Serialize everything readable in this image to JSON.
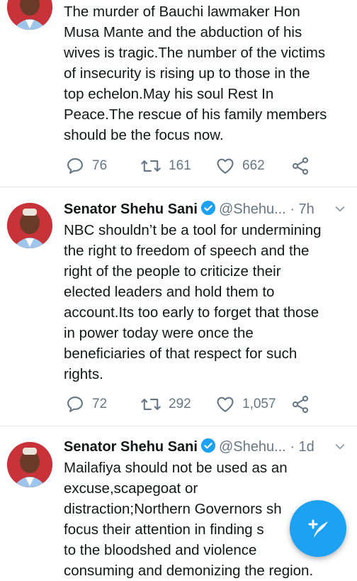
{
  "tweets": [
    {
      "text": "The murder of Bauchi lawmaker Hon\nMusa Mante and the abduction of his\nwives is tragic.The number of the victims\nof insecurity is rising up to those in the\ntop echelon.May his soul Rest In\nPeace.The rescue of his family members\nshould be the focus now.",
      "replies": "76",
      "retweets": "161",
      "likes": "662"
    },
    {
      "name": "Senator Shehu Sani",
      "handle": "@Shehu...",
      "time": "· 7h",
      "text": "NBC shouldn’t be a tool for undermining\nthe right to freedom of speech and the\nright of the people to criticize their\nelected leaders and hold them to\naccount.Its too early to forget that those\nin power today were once the\nbeneficiaries of that respect for such\nrights.",
      "replies": "72",
      "retweets": "292",
      "likes": "1,057"
    },
    {
      "name": "Senator Shehu Sani",
      "handle": "@Shehu...",
      "time": "· 1d",
      "text": "Mailafiya should not be used as an\nexcuse,scapegoat or\ndistraction;Northern Governors sh\nfocus their attention in finding s\nto the bloodshed and violence\nconsuming and demonizing the region."
    }
  ],
  "colors": {
    "accent": "#1da1f2",
    "muted": "#657786",
    "text": "#14171a",
    "divider": "#e1e8ed"
  },
  "icons": {
    "reply": "reply-icon",
    "retweet": "retweet-icon",
    "like": "heart-icon",
    "share": "share-icon",
    "compose": "compose-tweet-icon",
    "verified": "verified-badge-icon",
    "menu": "chevron-down-icon"
  }
}
